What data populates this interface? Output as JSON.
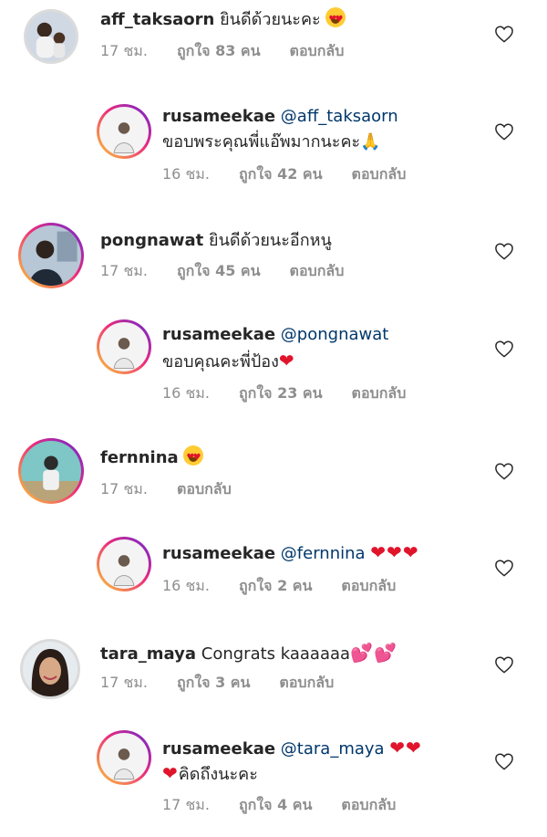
{
  "comments": [
    {
      "username": "aff_taksaorn",
      "text": "ยินดีด้วยนะคะ",
      "emoji": "heart-eyes",
      "time": "17 ชม.",
      "likes": "ถูกใจ 83 คน",
      "reply": "ตอบกลับ"
    },
    {
      "username": "rusameekae",
      "mention": "@aff_taksaorn",
      "text": "ขอบพระคุณพี่แอ๊พมากนะคะ",
      "emoji": "🙏",
      "time": "16 ชม.",
      "likes": "ถูกใจ 42 คน",
      "reply": "ตอบกลับ"
    },
    {
      "username": "pongnawat",
      "text": "ยินดีด้วยนะอีกหนู",
      "time": "17 ชม.",
      "likes": "ถูกใจ 45 คน",
      "reply": "ตอบกลับ"
    },
    {
      "username": "rusameekae",
      "mention": "@pongnawat",
      "text": "ขอบคุณคะพี่ป้อง",
      "emoji": "❤",
      "time": "16 ชม.",
      "likes": "ถูกใจ 23 คน",
      "reply": "ตอบกลับ"
    },
    {
      "username": "fernnina",
      "emoji": "heart-eyes",
      "time": "17 ชม.",
      "reply": "ตอบกลับ"
    },
    {
      "username": "rusameekae",
      "mention": "@fernnina",
      "emoji": "❤❤❤",
      "time": "16 ชม.",
      "likes": "ถูกใจ 2 คน",
      "reply": "ตอบกลับ"
    },
    {
      "username": "tara_maya",
      "text": "Congrats kaaaaaa",
      "emoji": "💕💕",
      "time": "17 ชม.",
      "likes": "ถูกใจ 3 คน",
      "reply": "ตอบกลับ"
    },
    {
      "username": "rusameekae",
      "mention": "@tara_maya",
      "emoji": "❤❤",
      "text2": "คิดถึงนะคะ",
      "emoji2": "❤",
      "time": "17 ชม.",
      "likes": "ถูกใจ 4 คน",
      "reply": "ตอบกลับ"
    }
  ],
  "icons": {
    "like": "heart-outline-icon"
  },
  "colors": {
    "mention": "#00376b",
    "meta": "#8e8e8e",
    "heart": "#e0142b"
  }
}
